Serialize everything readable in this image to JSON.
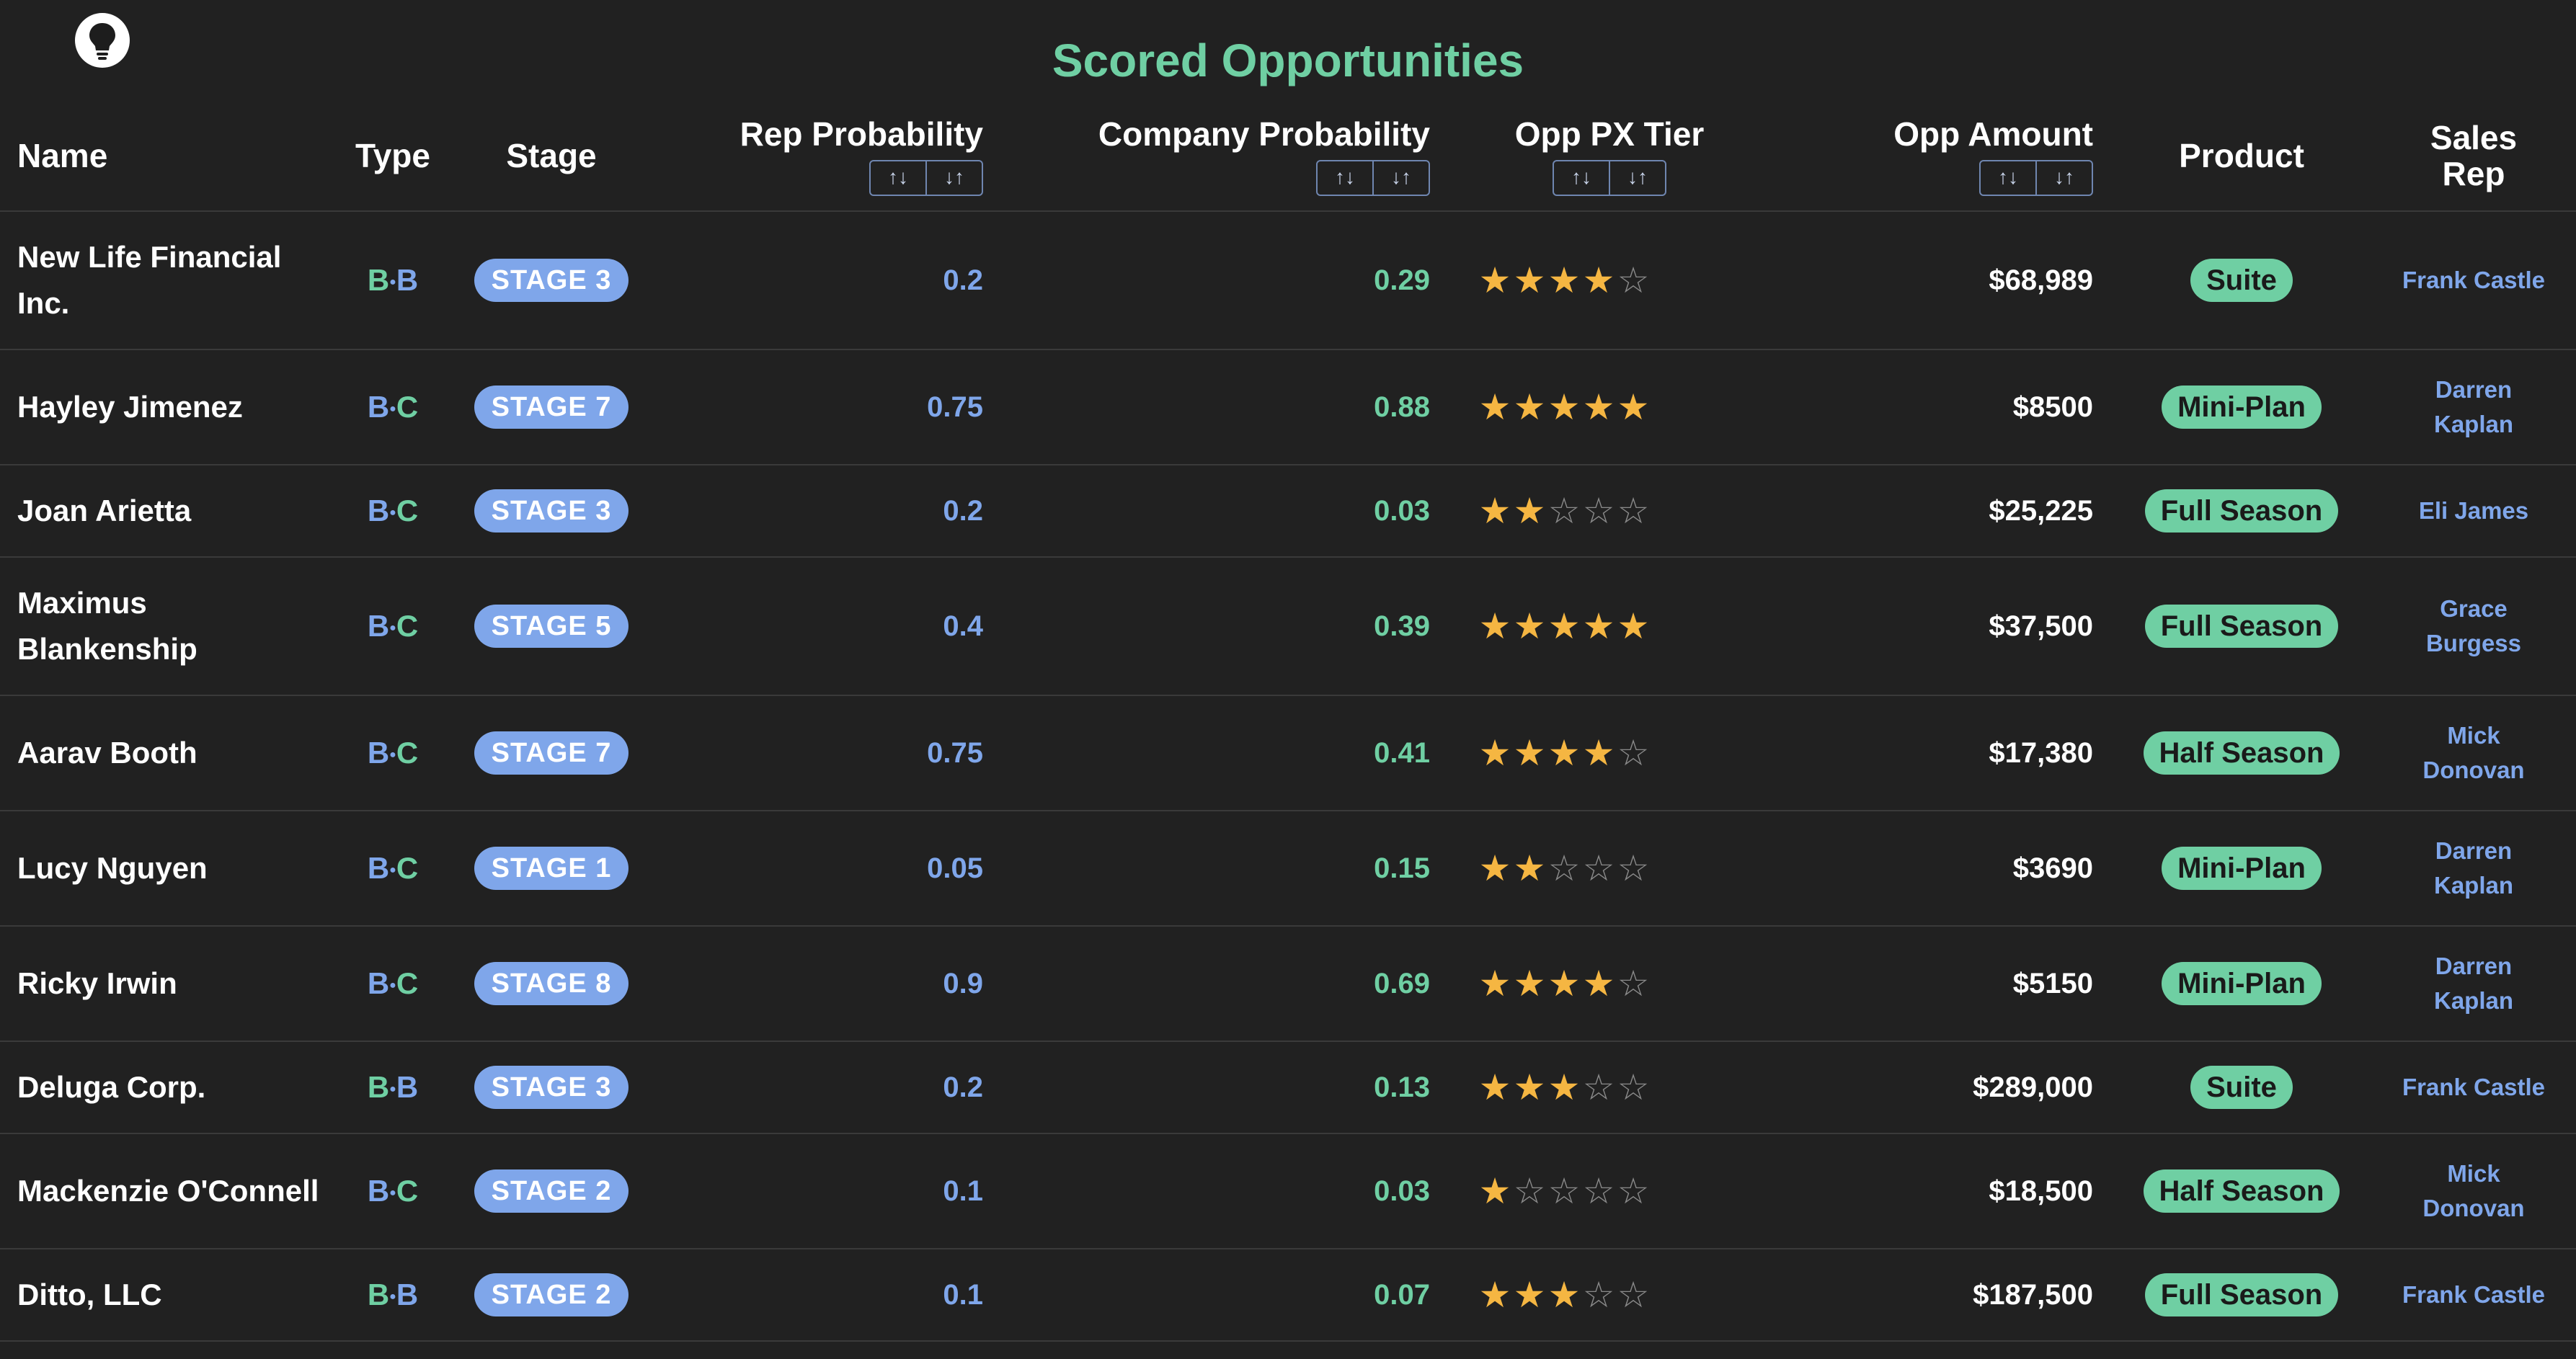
{
  "title": "Scored Opportunities",
  "colors": {
    "accent_green": "#6fcfa3",
    "accent_blue": "#7fa6ea",
    "star": "#f5b642",
    "background": "#212121"
  },
  "icons": {
    "logo": "lightbulb-icon",
    "sort_asc": "arrow-up-down-icon",
    "sort_desc": "arrow-down-up-icon"
  },
  "columns": {
    "name": "Name",
    "type": "Type",
    "stage": "Stage",
    "rep_probability": "Rep Probability",
    "company_probability": "Company Probability",
    "opp_px_tier": "Opp PX Tier",
    "opp_amount": "Opp Amount",
    "product": "Product",
    "sales_rep_line1": "Sales",
    "sales_rep_line2": "Rep"
  },
  "sort": {
    "asc": "↑↓",
    "desc": "↓↑"
  },
  "rows": [
    {
      "name": "New Life Financial Inc.",
      "type": [
        "B",
        "B"
      ],
      "type_kind": "b2b",
      "stage": "STAGE 3",
      "rep_probability": "0.2",
      "company_probability": "0.29",
      "tier_stars": 4,
      "amount": "$68,989",
      "product": "Suite",
      "sales_rep": "Frank Castle"
    },
    {
      "name": "Hayley Jimenez",
      "type": [
        "B",
        "C"
      ],
      "type_kind": "b2c",
      "stage": "STAGE 7",
      "rep_probability": "0.75",
      "company_probability": "0.88",
      "tier_stars": 5,
      "amount": "$8500",
      "product": "Mini-Plan",
      "sales_rep": "Darren Kaplan"
    },
    {
      "name": "Joan Arietta",
      "type": [
        "B",
        "C"
      ],
      "type_kind": "b2c",
      "stage": "STAGE 3",
      "rep_probability": "0.2",
      "company_probability": "0.03",
      "tier_stars": 2,
      "amount": "$25,225",
      "product": "Full Season",
      "sales_rep": "Eli James"
    },
    {
      "name": "Maximus Blankenship",
      "type": [
        "B",
        "C"
      ],
      "type_kind": "b2c",
      "stage": "STAGE 5",
      "rep_probability": "0.4",
      "company_probability": "0.39",
      "tier_stars": 5,
      "amount": "$37,500",
      "product": "Full Season",
      "sales_rep": "Grace Burgess"
    },
    {
      "name": "Aarav Booth",
      "type": [
        "B",
        "C"
      ],
      "type_kind": "b2c",
      "stage": "STAGE 7",
      "rep_probability": "0.75",
      "company_probability": "0.41",
      "tier_stars": 4,
      "amount": "$17,380",
      "product": "Half Season",
      "sales_rep": "Mick Donovan"
    },
    {
      "name": "Lucy Nguyen",
      "type": [
        "B",
        "C"
      ],
      "type_kind": "b2c",
      "stage": "STAGE 1",
      "rep_probability": "0.05",
      "company_probability": "0.15",
      "tier_stars": 2,
      "amount": "$3690",
      "product": "Mini-Plan",
      "sales_rep": "Darren Kaplan"
    },
    {
      "name": "Ricky Irwin",
      "type": [
        "B",
        "C"
      ],
      "type_kind": "b2c",
      "stage": "STAGE 8",
      "rep_probability": "0.9",
      "company_probability": "0.69",
      "tier_stars": 4,
      "amount": "$5150",
      "product": "Mini-Plan",
      "sales_rep": "Darren Kaplan"
    },
    {
      "name": "Deluga Corp.",
      "type": [
        "B",
        "B"
      ],
      "type_kind": "b2b",
      "stage": "STAGE 3",
      "rep_probability": "0.2",
      "company_probability": "0.13",
      "tier_stars": 3,
      "amount": "$289,000",
      "product": "Suite",
      "sales_rep": "Frank Castle"
    },
    {
      "name": "Mackenzie O'Connell",
      "type": [
        "B",
        "C"
      ],
      "type_kind": "b2c",
      "stage": "STAGE 2",
      "rep_probability": "0.1",
      "company_probability": "0.03",
      "tier_stars": 1,
      "amount": "$18,500",
      "product": "Half Season",
      "sales_rep": "Mick Donovan"
    },
    {
      "name": "Ditto, LLC",
      "type": [
        "B",
        "B"
      ],
      "type_kind": "b2b",
      "stage": "STAGE 2",
      "rep_probability": "0.1",
      "company_probability": "0.07",
      "tier_stars": 3,
      "amount": "$187,500",
      "product": "Full Season",
      "sales_rep": "Frank Castle"
    }
  ]
}
